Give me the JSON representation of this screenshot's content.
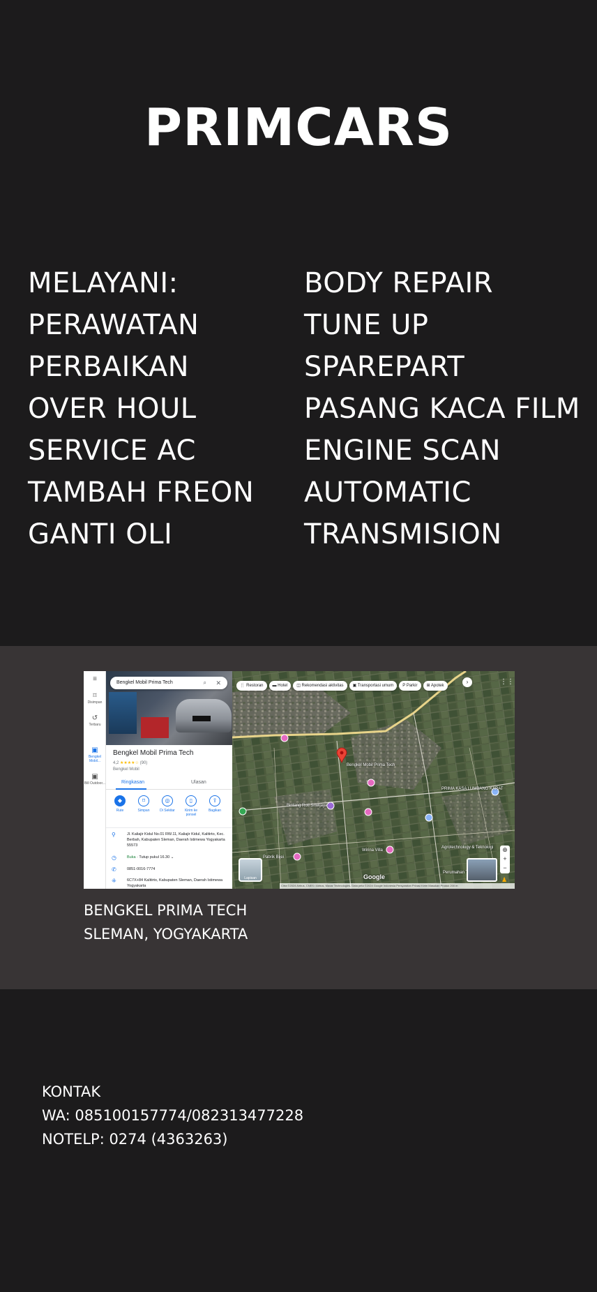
{
  "brand": "PRIMCARS",
  "services": {
    "left": [
      "MELAYANI:",
      "PERAWATAN",
      "PERBAIKAN",
      "OVER HOUL",
      "SERVICE AC",
      "TAMBAH FREON",
      "GANTI OLI"
    ],
    "right": [
      "BODY REPAIR",
      "TUNE UP",
      "SPAREPART",
      "PASANG KACA FILM",
      "ENGINE SCAN",
      "AUTOMATIC",
      "TRANSMISION"
    ]
  },
  "map": {
    "search_query": "Bengkel Mobil Prima Tech",
    "rail": [
      {
        "label": "Disimpan",
        "icon": "bookmark-icon"
      },
      {
        "label": "Terbaru",
        "icon": "history-icon"
      },
      {
        "label": "Bengkel Mobil...",
        "icon": "place-thumb-icon"
      },
      {
        "label": "Bill Outdoor...",
        "icon": "place-thumb-icon"
      }
    ],
    "place_name": "Bengkel Mobil Prima Tech",
    "rating": "4,2",
    "stars": "★★★★☆",
    "review_count": "(90)",
    "category": "Bengkel Mobil",
    "tabs": [
      "Ringkasan",
      "Ulasan"
    ],
    "actions": [
      {
        "label": "Rute",
        "icon": "directions-icon"
      },
      {
        "label": "Simpan",
        "icon": "bookmark-icon"
      },
      {
        "label": "Di Sekitar",
        "icon": "nearby-icon"
      },
      {
        "label": "Kirim ke ponsel",
        "icon": "send-to-phone-icon"
      },
      {
        "label": "Bagikan",
        "icon": "share-icon"
      }
    ],
    "address": "Jl. Kaliajir Kidul No.01 RW.11, Kaliajir Kidul, Kalitirto, Kec. Berbah, Kabupaten Sleman, Daerah Istimewa Yogyakarta 55573",
    "hours_status": "Buka",
    "hours_detail": " · Tutup pukul 16.30",
    "phone": "0851-0016-7774",
    "plus_code": "6C7X+84 Kalitirto, Kabupaten Sleman, Daerah Istimewa Yogyakarta",
    "chips": [
      "Restoran",
      "Hotel",
      "Rekomendasi aktivitas",
      "Transportasi umum",
      "Parkir",
      "Apotek"
    ],
    "map_labels": [
      {
        "text": "Bengkel Mobil Prima Tech"
      },
      {
        "text": "Bintang Roti Sriwijaya"
      },
      {
        "text": "Wirina Villa"
      },
      {
        "text": "PRIMA KASA LUMBANG KARAT"
      },
      {
        "text": "Pabrik Bijei"
      },
      {
        "text": "Agrotechnology & Teknologi"
      },
      {
        "text": "Perumahan Tanjung Raya"
      }
    ],
    "layers_label": "Lapisan",
    "google_logo": "Google",
    "attribution": "Citra ©2024 Airbus, CNES / Airbus, Maxar Technologies, Data peta ©2024 Google   Indonesia   Persyaratan   Privasi   Kirim Masukan Produk   200 m"
  },
  "location": {
    "line1": "BENGKEL PRIMA TECH",
    "line2": "SLEMAN, YOGYAKARTA"
  },
  "contact": {
    "heading": "KONTAK",
    "wa": "WA: 085100157774/082313477228",
    "phone": "NOTELP: 0274 (4363263)"
  },
  "colors": {
    "background": "#1c1b1c",
    "map_section": "#383435",
    "text": "#ffffff",
    "maps_blue": "#1a73e8"
  }
}
